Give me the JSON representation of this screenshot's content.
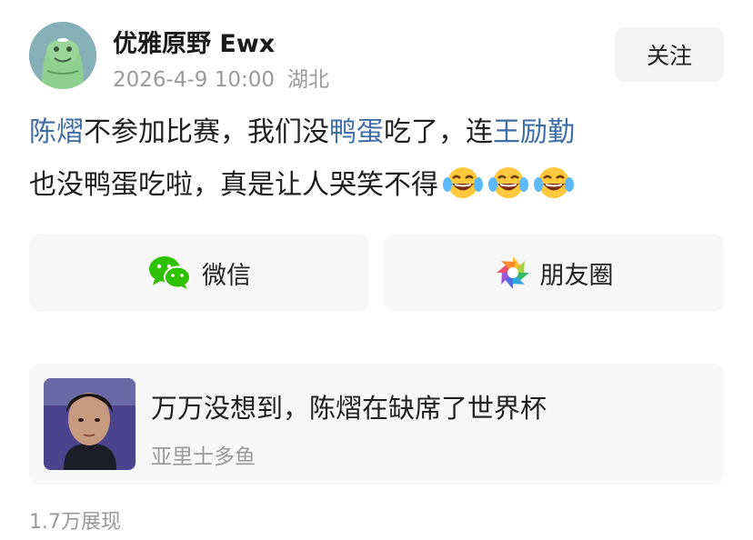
{
  "header": {
    "username": "优雅原野 Ewx",
    "timestamp": "2026-4-9 10:00",
    "location": "湖北",
    "follow_label": "关注",
    "avatar_icon": "green-cartoon-avatar"
  },
  "post": {
    "segments": [
      {
        "text": "陈熠",
        "link": true
      },
      {
        "text": "不参加比赛，我们没",
        "link": false
      },
      {
        "text": "鸭蛋",
        "link": true
      },
      {
        "text": "吃了，连",
        "link": false
      },
      {
        "text": "王励勤",
        "link": true
      },
      {
        "text": "也没鸭蛋吃啦，真是让人哭笑不得",
        "link": false
      }
    ],
    "emoji": [
      "laughing-crying-emoji",
      "laughing-crying-emoji",
      "laughing-crying-emoji"
    ]
  },
  "share": {
    "wechat_label": "微信",
    "moments_label": "朋友圈",
    "wechat_color": "#2dc100"
  },
  "card": {
    "title": "万万没想到，陈熠在缺席了世界杯",
    "author": "亚里士多鱼"
  },
  "footer": {
    "views": "1.7万展现"
  },
  "colors": {
    "link": "#3f6ea6",
    "muted": "#9a9a9a",
    "panel": "#f7f7f7"
  }
}
